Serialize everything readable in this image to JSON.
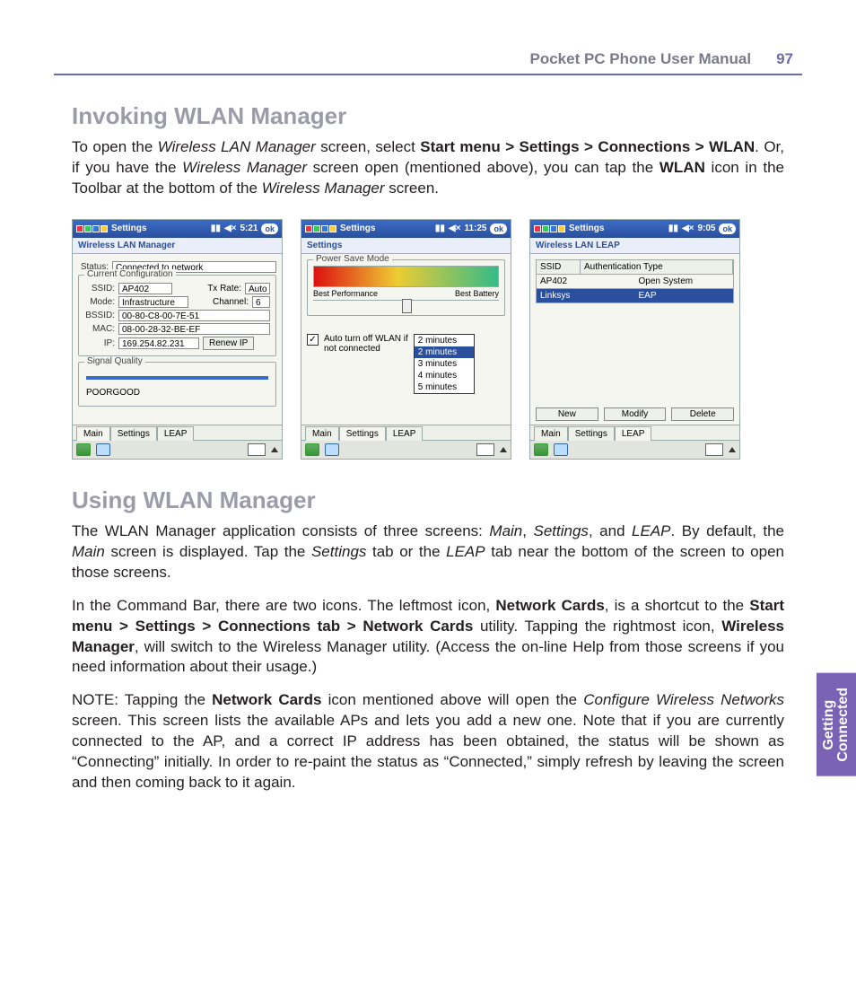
{
  "header": {
    "title": "Pocket PC Phone User Manual",
    "page": "97"
  },
  "sideTab": {
    "l1": "Getting",
    "l2": "Connected"
  },
  "s1": {
    "heading": "Invoking WLAN Manager",
    "p1a": "To open the ",
    "p1b": "Wireless LAN Manager",
    "p1c": " screen, select ",
    "p1d": "Start menu > Settings > Connections > WLAN",
    "p1e": ".  Or, if you have the ",
    "p1f": "Wireless Manager",
    "p1g": " screen open (mentioned above), you can tap the ",
    "p1h": "WLAN",
    "p1i": " icon in the Toolbar at the bottom of the ",
    "p1j": "Wireless Manager",
    "p1k": " screen."
  },
  "shot1": {
    "barApp": "Settings",
    "clock": "5:21",
    "ok": "ok",
    "sub": "Wireless LAN Manager",
    "statusLabel": "Status:",
    "statusVal": "Connected to network",
    "grpCurrent": "Current Configuration",
    "ssidL": "SSID:",
    "ssidV": "AP402",
    "txL": "Tx Rate:",
    "txV": "Auto",
    "modeL": "Mode:",
    "modeV": "Infrastructure",
    "chL": "Channel:",
    "chV": "6",
    "bssidL": "BSSID:",
    "bssidV": "00-80-C8-00-7E-51",
    "macL": "MAC:",
    "macV": "08-00-28-32-BE-EF",
    "ipL": "IP:",
    "ipV": "169.254.82.231",
    "renew": "Renew IP",
    "grpSig": "Signal Quality",
    "poor": "POOR",
    "good": "GOOD",
    "tabs": [
      "Main",
      "Settings",
      "LEAP"
    ],
    "active": 0
  },
  "shot2": {
    "barApp": "Settings",
    "clock": "11:25",
    "ok": "ok",
    "sub": "Settings",
    "grpPower": "Power Save Mode",
    "bestPerf": "Best Performance",
    "bestBatt": "Best Battery",
    "chkLabel1": "Auto turn off WLAN if",
    "chkLabel2": "not connected",
    "dd": [
      "2 minutes",
      "2 minutes",
      "3 minutes",
      "4 minutes",
      "5 minutes"
    ],
    "ddSel": 1,
    "tabs": [
      "Main",
      "Settings",
      "LEAP"
    ],
    "active": 1
  },
  "shot3": {
    "barApp": "Settings",
    "clock": "9:05",
    "ok": "ok",
    "sub": "Wireless LAN LEAP",
    "th1": "SSID",
    "th2": "Authentication Type",
    "r1c1": "AP402",
    "r1c2": "Open System",
    "r2c1": "Linksys",
    "r2c2": "EAP",
    "bNew": "New",
    "bMod": "Modify",
    "bDel": "Delete",
    "tabs": [
      "Main",
      "Settings",
      "LEAP"
    ],
    "active": 2
  },
  "s2": {
    "heading": "Using WLAN Manager",
    "p1a": "The WLAN Manager application consists of three screens:  ",
    "p1b": "Main",
    "p1c": ", ",
    "p1d": "Settings",
    "p1e": ", and ",
    "p1f": "LEAP",
    "p1g": ".  By default, the ",
    "p1h": "Main",
    "p1i": " screen is displayed.  Tap the ",
    "p1j": "Settings",
    "p1k": " tab or the ",
    "p1l": "LEAP",
    "p1m": " tab near the bottom of the screen to open those screens.",
    "p2a": "In the Command Bar, there are two icons.  The leftmost icon, ",
    "p2b": "Network Cards",
    "p2c": ", is a shortcut to the ",
    "p2d": "Start menu > Settings > Connections tab > Network Cards",
    "p2e": " utility.  Tapping the rightmost icon, ",
    "p2f": "Wireless Manager",
    "p2g": ", will switch to the Wireless Manager utility.  (Access the on-line Help from those screens if you need information about their usage.)",
    "p3a": "NOTE:  Tapping the ",
    "p3b": "Network Cards",
    "p3c": " icon mentioned above will open the ",
    "p3d": "Configure Wireless Networks",
    "p3e": " screen.  This screen lists the available APs and lets you add a new one.  Note that if you are currently connected to the AP, and a correct IP address has been obtained, the status will be shown as “Connecting” initially.  In order to re-paint the status as “Connected,” simply refresh by leaving the screen and then coming back to it again."
  }
}
